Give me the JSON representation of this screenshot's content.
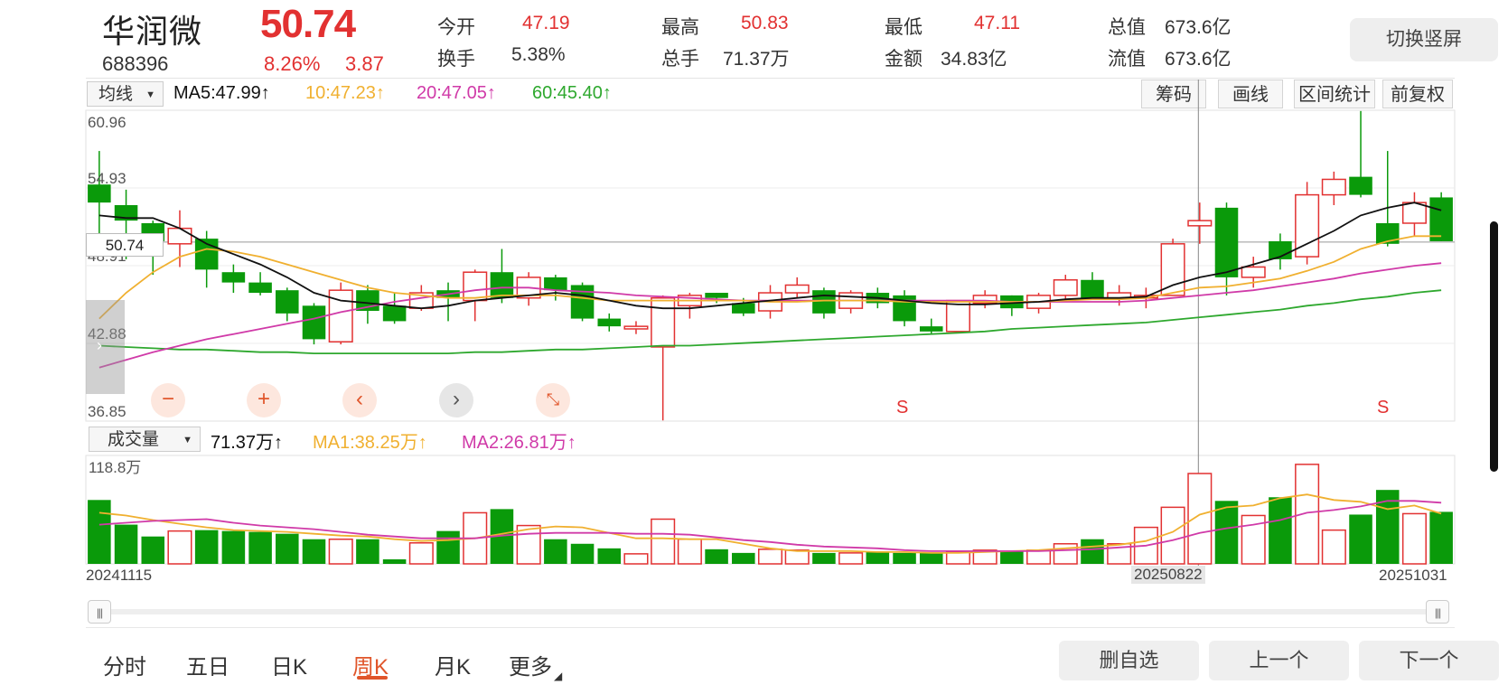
{
  "stock": {
    "name": "华润微",
    "code": "688396",
    "price": "50.74",
    "change_pct": "8.26%",
    "change": "3.87"
  },
  "quote": {
    "open_label": "今开",
    "open": "47.19",
    "high_label": "最高",
    "high": "50.83",
    "low_label": "最低",
    "low": "47.11",
    "mktcap_label": "总值",
    "mktcap": "673.6亿",
    "turnover_label": "换手",
    "turnover": "5.38%",
    "volume_label": "总手",
    "volume": "71.37万",
    "amount_label": "金额",
    "amount": "34.83亿",
    "float_label": "流值",
    "float_cap": "673.6亿"
  },
  "header": {
    "switch_portrait": "切换竖屏"
  },
  "ma_bar": {
    "selector": "均线",
    "ma5": "MA5:47.99↑",
    "ma10": "10:47.23↑",
    "ma20": "20:47.05↑",
    "ma60": "60:45.40↑"
  },
  "tools": {
    "chips": "筹码",
    "draw": "画线",
    "range_stats": "区间统计",
    "adjust": "前复权"
  },
  "price_axis": {
    "top": "60.96",
    "upper": "54.93",
    "mid": "48.91",
    "lower": "42.88",
    "bottom": "36.85",
    "cursor": "50.74"
  },
  "signals": [
    "S",
    "S"
  ],
  "vol_bar": {
    "selector": "成交量",
    "vol": "71.37万↑",
    "ma1": "MA1:38.25万↑",
    "ma2": "MA2:26.81万↑",
    "axis_top": "118.8万"
  },
  "dates": {
    "start": "20241115",
    "cursor": "20250822",
    "end": "20251031"
  },
  "tabs": [
    {
      "label": "分时"
    },
    {
      "label": "五日"
    },
    {
      "label": "日K"
    },
    {
      "label": "周K"
    },
    {
      "label": "月K"
    },
    {
      "label": "更多"
    }
  ],
  "buttons": {
    "remove_fav": "删自选",
    "prev": "上一个",
    "next": "下一个"
  },
  "colors": {
    "up": "#e23131",
    "down": "#0a9a0a",
    "ma5": "#111111",
    "ma10": "#f0b030",
    "ma20": "#d03aa8",
    "ma60": "#2ea82e",
    "accent": "#e0552a"
  },
  "chart_data": {
    "type": "candlestick",
    "y_range": [
      36.85,
      60.96
    ],
    "candles": [
      {
        "o": 55.2,
        "h": 57.8,
        "l": 51.0,
        "c": 53.8
      },
      {
        "o": 53.6,
        "h": 54.8,
        "l": 49.4,
        "c": 52.4
      },
      {
        "o": 52.2,
        "h": 52.4,
        "l": 48.2,
        "c": 50.8
      },
      {
        "o": 50.6,
        "h": 53.2,
        "l": 48.8,
        "c": 51.8
      },
      {
        "o": 51.0,
        "h": 51.6,
        "l": 47.2,
        "c": 48.6
      },
      {
        "o": 48.4,
        "h": 49.0,
        "l": 46.8,
        "c": 47.6
      },
      {
        "o": 47.6,
        "h": 48.4,
        "l": 46.6,
        "c": 46.8
      },
      {
        "o": 47.0,
        "h": 47.2,
        "l": 44.6,
        "c": 45.2
      },
      {
        "o": 45.8,
        "h": 46.0,
        "l": 42.8,
        "c": 43.2
      },
      {
        "o": 43.0,
        "h": 47.6,
        "l": 42.8,
        "c": 47.0
      },
      {
        "o": 47.0,
        "h": 47.4,
        "l": 44.4,
        "c": 45.4
      },
      {
        "o": 45.8,
        "h": 46.8,
        "l": 44.4,
        "c": 44.6
      },
      {
        "o": 45.6,
        "h": 47.4,
        "l": 45.4,
        "c": 46.8
      },
      {
        "o": 47.0,
        "h": 47.6,
        "l": 44.6,
        "c": 46.4
      },
      {
        "o": 46.2,
        "h": 48.6,
        "l": 44.6,
        "c": 48.4
      },
      {
        "o": 48.4,
        "h": 50.2,
        "l": 46.0,
        "c": 46.4
      },
      {
        "o": 46.4,
        "h": 48.4,
        "l": 45.8,
        "c": 48.0
      },
      {
        "o": 48.0,
        "h": 48.2,
        "l": 46.2,
        "c": 47.0
      },
      {
        "o": 47.4,
        "h": 47.6,
        "l": 44.6,
        "c": 44.8
      },
      {
        "o": 44.8,
        "h": 45.2,
        "l": 43.8,
        "c": 44.2
      },
      {
        "o": 44.0,
        "h": 44.6,
        "l": 43.6,
        "c": 44.2
      },
      {
        "o": 42.6,
        "h": 46.6,
        "l": 36.9,
        "c": 46.4
      },
      {
        "o": 45.8,
        "h": 46.8,
        "l": 44.8,
        "c": 46.6
      },
      {
        "o": 46.8,
        "h": 46.8,
        "l": 46.0,
        "c": 46.4
      },
      {
        "o": 46.0,
        "h": 46.4,
        "l": 45.0,
        "c": 45.2
      },
      {
        "o": 45.4,
        "h": 47.4,
        "l": 44.8,
        "c": 46.8
      },
      {
        "o": 46.8,
        "h": 48.0,
        "l": 46.4,
        "c": 47.4
      },
      {
        "o": 47.0,
        "h": 47.2,
        "l": 44.8,
        "c": 45.2
      },
      {
        "o": 45.6,
        "h": 47.0,
        "l": 45.2,
        "c": 46.8
      },
      {
        "o": 46.8,
        "h": 47.2,
        "l": 45.6,
        "c": 46.0
      },
      {
        "o": 46.6,
        "h": 47.0,
        "l": 44.2,
        "c": 44.6
      },
      {
        "o": 44.2,
        "h": 44.8,
        "l": 43.6,
        "c": 43.8
      },
      {
        "o": 43.8,
        "h": 46.2,
        "l": 43.8,
        "c": 46.2
      },
      {
        "o": 46.0,
        "h": 47.0,
        "l": 45.6,
        "c": 46.6
      },
      {
        "o": 46.6,
        "h": 46.6,
        "l": 45.0,
        "c": 45.6
      },
      {
        "o": 45.6,
        "h": 46.8,
        "l": 45.2,
        "c": 46.6
      },
      {
        "o": 46.6,
        "h": 48.2,
        "l": 46.2,
        "c": 47.8
      },
      {
        "o": 47.8,
        "h": 48.4,
        "l": 46.4,
        "c": 46.4
      },
      {
        "o": 46.4,
        "h": 47.4,
        "l": 45.8,
        "c": 46.8
      },
      {
        "o": 46.4,
        "h": 47.2,
        "l": 45.6,
        "c": 46.6
      },
      {
        "o": 46.6,
        "h": 51.0,
        "l": 46.6,
        "c": 50.6
      },
      {
        "o": 52.0,
        "h": 53.8,
        "l": 50.6,
        "c": 52.4
      },
      {
        "o": 53.4,
        "h": 53.8,
        "l": 46.6,
        "c": 48.0
      },
      {
        "o": 48.0,
        "h": 49.6,
        "l": 47.2,
        "c": 48.8
      },
      {
        "o": 50.8,
        "h": 51.4,
        "l": 48.6,
        "c": 49.4
      },
      {
        "o": 49.6,
        "h": 55.4,
        "l": 49.0,
        "c": 54.4
      },
      {
        "o": 54.4,
        "h": 56.2,
        "l": 53.6,
        "c": 55.6
      },
      {
        "o": 55.8,
        "h": 60.9,
        "l": 54.2,
        "c": 54.4
      },
      {
        "o": 52.2,
        "h": 57.8,
        "l": 50.4,
        "c": 50.6
      },
      {
        "o": 52.2,
        "h": 54.6,
        "l": 51.2,
        "c": 53.8
      },
      {
        "o": 54.2,
        "h": 54.6,
        "l": 50.8,
        "c": 50.8
      }
    ],
    "ma5": [
      52.8,
      52.6,
      52.6,
      51.8,
      50.6,
      49.8,
      49.0,
      48.0,
      46.8,
      46.2,
      46.0,
      45.8,
      45.6,
      45.8,
      46.2,
      46.4,
      46.6,
      46.8,
      46.6,
      46.2,
      45.8,
      45.6,
      45.6,
      45.8,
      46.0,
      46.2,
      46.4,
      46.6,
      46.5,
      46.4,
      46.2,
      46.0,
      45.9,
      45.9,
      46.0,
      46.1,
      46.3,
      46.4,
      46.4,
      46.5,
      47.4,
      48.0,
      48.4,
      49.0,
      49.6,
      50.6,
      51.6,
      52.8,
      53.4,
      53.8,
      53.2
    ],
    "ma10": [
      44.8,
      46.8,
      48.4,
      49.6,
      50.2,
      50.0,
      49.6,
      49.0,
      48.4,
      47.8,
      47.2,
      46.8,
      46.6,
      46.4,
      46.4,
      46.6,
      46.6,
      46.6,
      46.4,
      46.2,
      46.2,
      46.2,
      46.2,
      46.2,
      46.2,
      46.1,
      46.1,
      46.2,
      46.2,
      46.2,
      46.1,
      46.1,
      46.1,
      46.1,
      46.1,
      46.1,
      46.2,
      46.3,
      46.3,
      46.4,
      46.8,
      47.2,
      47.3,
      47.6,
      47.9,
      48.5,
      49.2,
      50.2,
      50.8,
      51.2,
      51.2
    ],
    "ma20": [
      41.0,
      41.6,
      42.2,
      42.7,
      43.2,
      43.6,
      44.0,
      44.4,
      44.8,
      45.3,
      45.7,
      46.1,
      46.4,
      46.7,
      47.0,
      47.2,
      47.2,
      47.0,
      46.9,
      46.8,
      46.6,
      46.5,
      46.4,
      46.3,
      46.2,
      46.2,
      46.2,
      46.2,
      46.2,
      46.2,
      46.2,
      46.2,
      46.2,
      46.2,
      46.1,
      46.1,
      46.1,
      46.1,
      46.1,
      46.2,
      46.4,
      46.6,
      46.8,
      47.0,
      47.3,
      47.6,
      47.9,
      48.3,
      48.6,
      48.9,
      49.1
    ],
    "ma60": [
      42.7,
      42.6,
      42.5,
      42.4,
      42.4,
      42.3,
      42.2,
      42.2,
      42.1,
      42.1,
      42.1,
      42.1,
      42.1,
      42.1,
      42.2,
      42.2,
      42.3,
      42.4,
      42.4,
      42.5,
      42.6,
      42.7,
      42.7,
      42.8,
      42.9,
      43.0,
      43.1,
      43.2,
      43.3,
      43.4,
      43.5,
      43.6,
      43.7,
      43.8,
      44.0,
      44.1,
      44.2,
      44.3,
      44.4,
      44.5,
      44.7,
      44.9,
      45.1,
      45.3,
      45.5,
      45.8,
      46.0,
      46.3,
      46.5,
      46.8,
      47.0
    ],
    "signal_bars": [
      30,
      48
    ],
    "cursor_bar": 40,
    "volume_range": [
      0,
      118.8
    ],
    "volume": [
      70,
      43,
      30,
      36,
      37,
      36,
      35,
      33,
      27,
      27,
      27,
      5,
      23,
      36,
      56,
      60,
      42,
      27,
      22,
      17,
      11,
      49,
      27,
      16,
      12,
      16,
      15,
      12,
      12,
      13,
      12,
      12,
      13,
      15,
      14,
      15,
      22,
      27,
      22,
      40,
      62,
      99,
      69,
      53,
      73,
      109,
      37,
      54,
      81,
      55,
      57
    ],
    "vol_ma1": [
      56,
      53,
      48,
      44,
      40,
      37,
      36,
      35,
      33,
      31,
      30,
      27,
      25,
      26,
      28,
      33,
      38,
      41,
      40,
      34,
      28,
      28,
      27,
      27,
      22,
      17,
      14,
      14,
      14,
      13,
      13,
      12,
      12,
      13,
      14,
      15,
      17,
      19,
      21,
      25,
      35,
      54,
      62,
      64,
      72,
      76,
      70,
      68,
      60,
      64,
      55
    ],
    "vol_ma2": [
      43,
      45,
      47,
      48,
      49,
      45,
      42,
      40,
      38,
      35,
      32,
      30,
      28,
      28,
      28,
      31,
      33,
      34,
      34,
      34,
      33,
      33,
      32,
      29,
      26,
      24,
      21,
      19,
      18,
      17,
      15,
      14,
      14,
      14,
      14,
      14,
      15,
      16,
      18,
      20,
      26,
      34,
      39,
      43,
      48,
      56,
      59,
      63,
      69,
      69,
      67
    ]
  }
}
